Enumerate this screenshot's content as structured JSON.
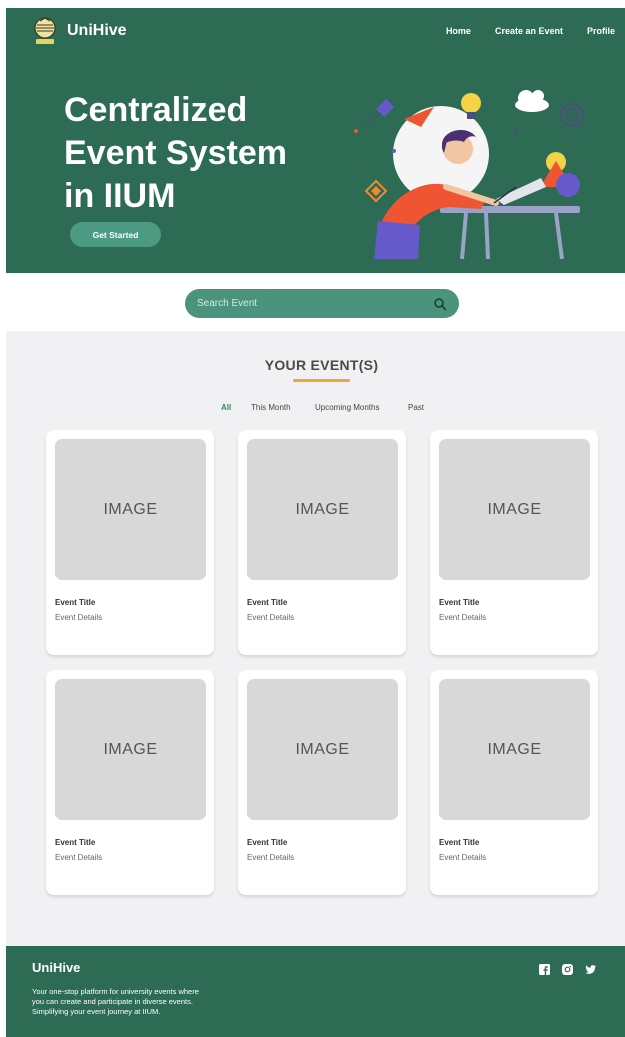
{
  "brand": "UniHive",
  "nav": {
    "items": [
      {
        "label": "Home"
      },
      {
        "label": "Create an Event"
      },
      {
        "label": "Profile"
      }
    ]
  },
  "hero": {
    "title_lines": [
      "Centralized",
      "Event System",
      "in IIUM"
    ],
    "cta_label": "Get Started"
  },
  "search": {
    "placeholder": "Search Event",
    "value": ""
  },
  "events": {
    "heading": "YOUR EVENT(S)",
    "filters": [
      {
        "label": "All",
        "active": true
      },
      {
        "label": "This Month",
        "active": false
      },
      {
        "label": "Upcoming Months",
        "active": false
      },
      {
        "label": "Past",
        "active": false
      }
    ],
    "cards": [
      {
        "image_label": "IMAGE",
        "title": "Event Title",
        "details": "Event Details"
      },
      {
        "image_label": "IMAGE",
        "title": "Event Title",
        "details": "Event Details"
      },
      {
        "image_label": "IMAGE",
        "title": "Event Title",
        "details": "Event Details"
      },
      {
        "image_label": "IMAGE",
        "title": "Event Title",
        "details": "Event Details"
      },
      {
        "image_label": "IMAGE",
        "title": "Event Title",
        "details": "Event Details"
      },
      {
        "image_label": "IMAGE",
        "title": "Event Title",
        "details": "Event Details"
      }
    ]
  },
  "footer": {
    "brand": "UniHive",
    "description_lines": [
      "Your one-stop platform for university events where",
      "you can create and participate in diverse events.",
      "Simplifying your event journey at IIUM."
    ],
    "socials": [
      "facebook-icon",
      "instagram-icon",
      "twitter-icon"
    ]
  },
  "colors": {
    "primary_green": "#2d6b55",
    "button_green": "#4d9a83",
    "search_green": "#4a947e",
    "accent_orange": "#f0a530",
    "section_bg": "#f1f1f3",
    "active_filter": "#2d8a6a"
  }
}
